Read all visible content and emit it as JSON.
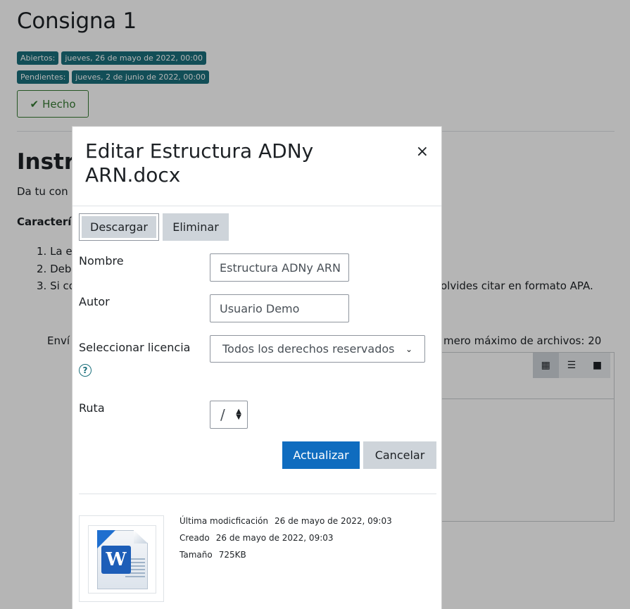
{
  "page": {
    "title": "Consigna 1",
    "dates": [
      {
        "label": "Abiertos:",
        "value": "jueves, 26 de mayo de 2022, 00:00"
      },
      {
        "label": "Pendientes:",
        "value": "jueves, 2 de junio de 2022, 00:00"
      }
    ],
    "done_label": "Hecho",
    "section_title": "Instru",
    "intro_text": "Da tu con",
    "features_label": "Caracterí",
    "list_items": [
      "1. La e",
      "2. Deb",
      "3. Si co"
    ],
    "list_tail": "olvides citar en formato APA.",
    "submit_prefix": "Enví",
    "max_files_text": "mero máximo de archivos: 20"
  },
  "modal": {
    "title": "Editar Estructura ADNy ARN.docx",
    "close_symbol": "×",
    "download_label": "Descargar",
    "delete_label": "Eliminar",
    "name_label": "Nombre",
    "name_value": "Estructura ADNy ARN",
    "author_label": "Autor",
    "author_value": "Usuario Demo",
    "license_label": "Seleccionar licencia",
    "license_value": "Todos los derechos reservados",
    "help_symbol": "?",
    "path_label": "Ruta",
    "path_value": "/",
    "update_label": "Actualizar",
    "cancel_label": "Cancelar",
    "file_icon": "word-document-icon",
    "file_icon_letter": "W",
    "meta": [
      {
        "label": "Última modicficación",
        "value": "26 de mayo de 2022, 09:03"
      },
      {
        "label": "Creado",
        "value": "26 de mayo de 2022, 09:03"
      },
      {
        "label": "Tamaño",
        "value": "725KB"
      }
    ]
  },
  "colors": {
    "primary": "#0f6cbf",
    "badge": "#1a6f7b",
    "success": "#357a32",
    "secondary": "#ced4da"
  }
}
